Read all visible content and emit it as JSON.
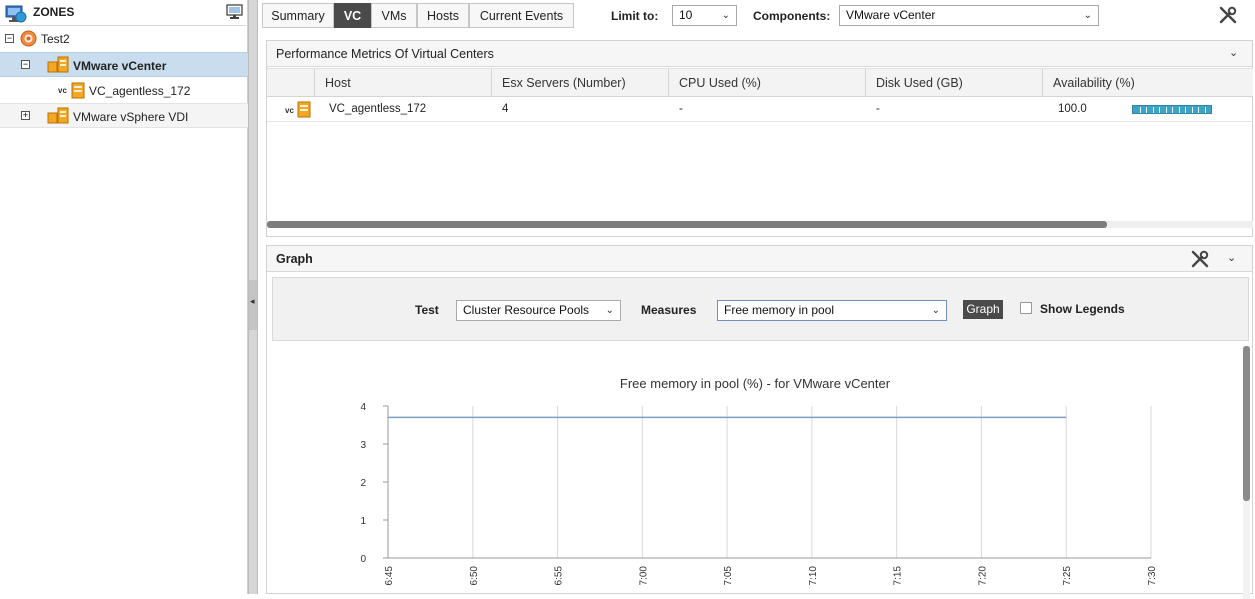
{
  "zones": {
    "title": "ZONES",
    "items": [
      {
        "label": "Test2",
        "expander": "−"
      },
      {
        "label": "VMware vCenter",
        "expander": "−"
      },
      {
        "label": "VC_agentless_172",
        "tag": "vc"
      },
      {
        "label": "VMware vSphere VDI",
        "expander": "+"
      }
    ]
  },
  "tabs": [
    {
      "label": "Summary"
    },
    {
      "label": "VC",
      "active": true
    },
    {
      "label": "VMs"
    },
    {
      "label": "Hosts"
    },
    {
      "label": "Current Events"
    }
  ],
  "limit": {
    "label": "Limit to:",
    "value": "10"
  },
  "components": {
    "label": "Components:",
    "value": "VMware vCenter"
  },
  "metrics_panel": {
    "title": "Performance Metrics Of Virtual Centers",
    "columns": [
      "Host",
      "Esx Servers (Number)",
      "CPU Used (%)",
      "Disk Used (GB)",
      "Availability (%)"
    ],
    "rows": [
      {
        "tag": "vc",
        "host": "VC_agentless_172",
        "esx_servers": "4",
        "cpu_used": "-",
        "disk_used": "-",
        "availability": "100.0",
        "availability_fraction": 1.0
      }
    ]
  },
  "graph_panel": {
    "title": "Graph",
    "test_label": "Test",
    "test_value": "Cluster Resource Pools",
    "measures_label": "Measures",
    "measures_value": "Free memory in pool",
    "graph_button": "Graph",
    "show_legends": "Show Legends"
  },
  "chart_data": {
    "type": "line",
    "title": "Free memory in pool (%) - for VMware vCenter",
    "xlabel": "",
    "ylabel": "",
    "x_ticks": [
      "6:45",
      "6:50",
      "6:55",
      "7:00",
      "7:05",
      "7:10",
      "7:15",
      "7:20",
      "7:25",
      "7:30"
    ],
    "y_ticks": [
      0,
      1,
      2,
      3,
      4
    ],
    "ylim": [
      0,
      4
    ],
    "series": [
      {
        "x": [
          "6:45",
          "7:25"
        ],
        "values": [
          3.7,
          3.7
        ],
        "color": "#7e9ec0"
      }
    ],
    "grid": true
  },
  "colors": {
    "active_tab": "#4a4a4a",
    "selected_row": "#c9ddef",
    "availability_bar": "#3fa3c6"
  }
}
